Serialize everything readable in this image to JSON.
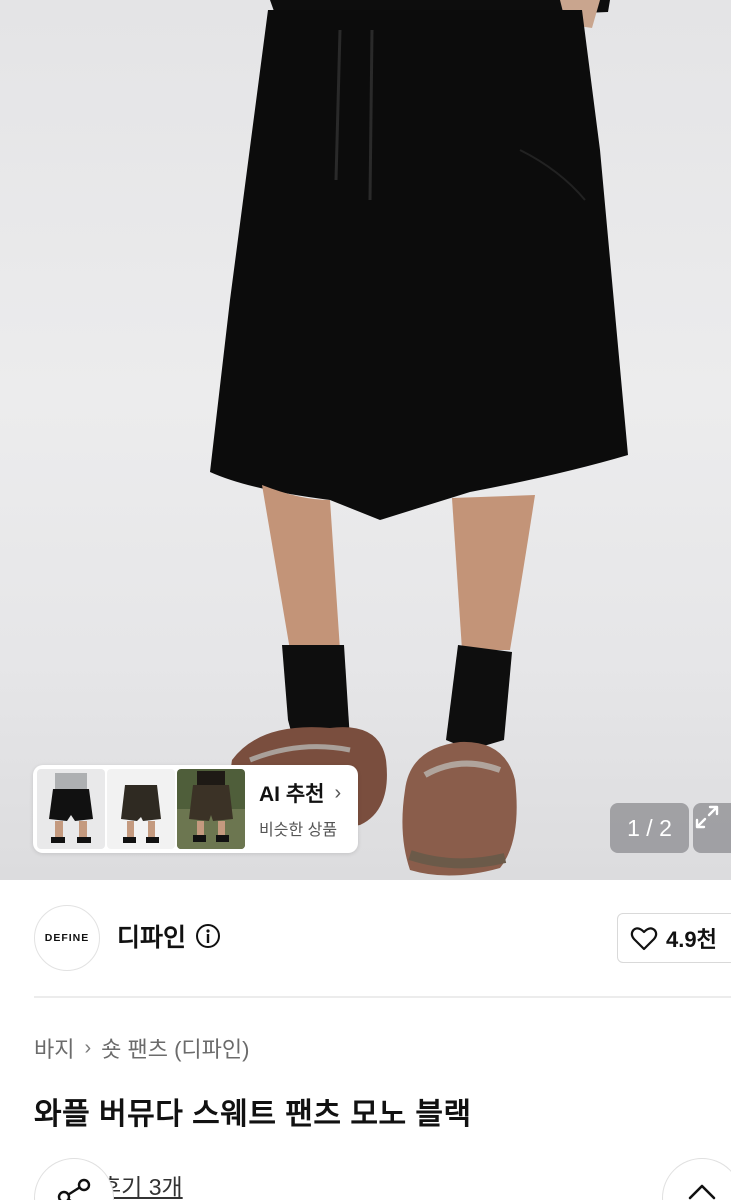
{
  "gallery": {
    "counter": "1 / 2",
    "ai_recommend": {
      "title": "AI 추천",
      "subtitle": "비슷한 상품"
    }
  },
  "brand": {
    "logo_text": "DEFINE",
    "name": "디파인",
    "likes": "4.9천"
  },
  "breadcrumb": {
    "category": "바지",
    "subcategory": "숏 팬츠 (디파인)"
  },
  "product": {
    "title": "와플 버뮤다 스웨트 팬츠 모노 블랙",
    "review_link": "후기 3개"
  },
  "colors": {
    "accent_text": "#111111",
    "muted_text": "#6b6b6b",
    "overlay": "#6e6e73"
  },
  "icons": [
    "chevron-right-icon",
    "expand-icon",
    "info-icon",
    "heart-icon",
    "share-icon",
    "chevron-up-icon"
  ]
}
